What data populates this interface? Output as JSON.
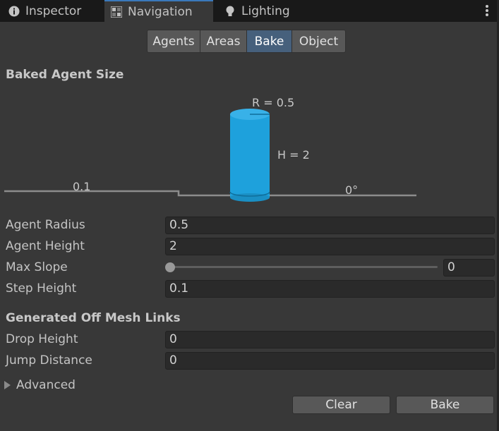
{
  "tabs": [
    {
      "label": "Inspector",
      "icon": "info-icon"
    },
    {
      "label": "Navigation",
      "icon": "navigation-icon"
    },
    {
      "label": "Lighting",
      "icon": "lightbulb-icon"
    }
  ],
  "active_tab": "Navigation",
  "segments": [
    "Agents",
    "Areas",
    "Bake",
    "Object"
  ],
  "active_segment": "Bake",
  "baked_agent_size": {
    "title": "Baked Agent Size",
    "radius_label": "R = 0.5",
    "height_label": "H = 2",
    "step_label": "0.1",
    "slope_label": "0°",
    "agent_color": "#1ea1dc"
  },
  "fields": {
    "agent_radius": {
      "label": "Agent Radius",
      "value": "0.5"
    },
    "agent_height": {
      "label": "Agent Height",
      "value": "2"
    },
    "max_slope": {
      "label": "Max Slope",
      "value": "0",
      "slider_fraction": 0.0
    },
    "step_height": {
      "label": "Step Height",
      "value": "0.1"
    }
  },
  "off_mesh": {
    "title": "Generated Off Mesh Links",
    "drop_height": {
      "label": "Drop Height",
      "value": "0"
    },
    "jump_distance": {
      "label": "Jump Distance",
      "value": "0"
    }
  },
  "advanced_label": "Advanced",
  "buttons": {
    "clear": "Clear",
    "bake": "Bake"
  }
}
